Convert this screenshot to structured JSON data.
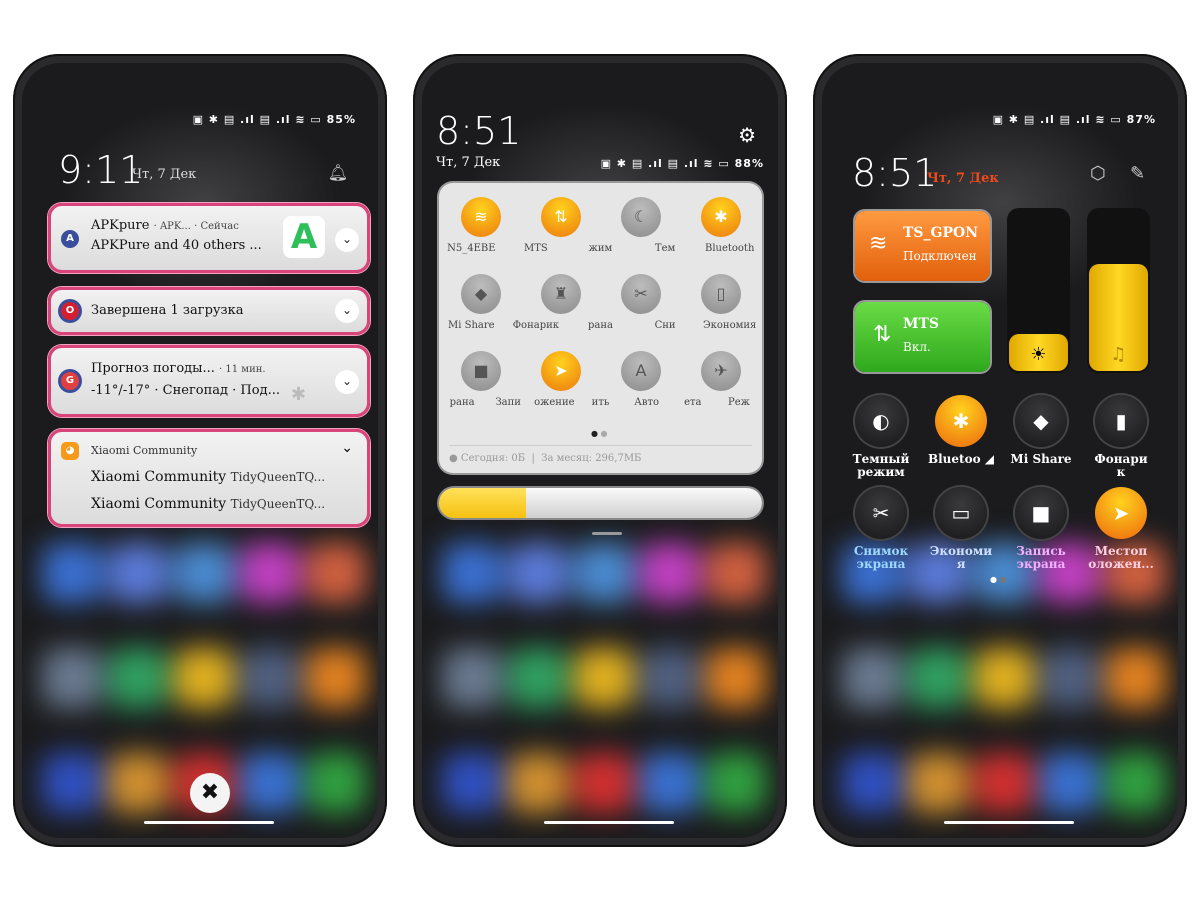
{
  "phone1": {
    "status": {
      "battery": "85%"
    },
    "time": "9:11",
    "date": "Чт, 7 Дек",
    "notifications": [
      {
        "app": "APKpure",
        "title": "APKpure",
        "meta": "· APK...  · Сейчас",
        "text": "APKPure and 40 others ...",
        "icon_color": "#3a4f9c"
      },
      {
        "app": "Opera",
        "title": "Завершена 1 загрузка",
        "icon_color": "#d32030"
      },
      {
        "app": "Weather",
        "title": "Прогноз погоды...",
        "meta": "· 11 мин.",
        "text": "-11°/-17° · Снегопад · Под...",
        "icon_color": "#e04040"
      },
      {
        "app": "Xiaomi Community",
        "header": "Xiaomi Community",
        "lines": [
          {
            "a": "Xiaomi Community",
            "b": "TidyQueenTQ..."
          },
          {
            "a": "Xiaomi Community",
            "b": "TidyQueenTQ..."
          }
        ],
        "icon_color": "#f59a1a"
      }
    ],
    "clear_icon": "close-icon"
  },
  "phone2": {
    "time": "8:51",
    "date": "Чт, 7 Дек",
    "status": {
      "battery": "88%"
    },
    "tiles": [
      {
        "label": "N5_4EBE",
        "on": true,
        "icon": "wifi-icon",
        "g": "≋"
      },
      {
        "label": "MTS",
        "on": true,
        "icon": "mobile-data-icon",
        "g": "⇅"
      },
      {
        "label": "жим",
        "on": false,
        "icon": "dark-mode-icon",
        "g": "☾"
      },
      {
        "label": "Тем",
        "on": false,
        "icon": "theme-icon",
        "g": ""
      },
      {
        "label": "Bluetooth",
        "on": true,
        "icon": "bluetooth-icon",
        "g": "✱"
      },
      {
        "label": "Mi Share",
        "on": false,
        "icon": "mi-share-icon",
        "g": "◆"
      },
      {
        "label": "Фонарик",
        "on": false,
        "icon": "flashlight-icon",
        "g": "♜"
      },
      {
        "label": "рана",
        "on": false,
        "icon": "screenshot-icon",
        "g": "✂"
      },
      {
        "label": "Сни",
        "on": false,
        "icon": "screenshot-icon",
        "g": ""
      },
      {
        "label": "Экономия",
        "on": false,
        "icon": "battery-saver-icon",
        "g": "▯"
      },
      {
        "label": "рана",
        "on": false,
        "icon": "screen-record-icon",
        "g": "■"
      },
      {
        "label": "Запи",
        "on": false,
        "icon": "record-icon",
        "g": ""
      },
      {
        "label": "ожение",
        "on": true,
        "icon": "location-icon",
        "g": "➤"
      },
      {
        "label": "ить",
        "on": false,
        "icon": "auto-brightness-icon",
        "g": "A"
      },
      {
        "label": "Авто",
        "on": false,
        "icon": "auto-icon",
        "g": ""
      },
      {
        "label": "ета",
        "on": false,
        "icon": "airplane-icon",
        "g": "✈"
      },
      {
        "label": "Реж",
        "on": false,
        "icon": "mode-icon",
        "g": ""
      }
    ],
    "data_today": "Сегодня: 0Б",
    "data_month": "За месяц: 296,7МБ",
    "brightness": 0.27
  },
  "phone3": {
    "status": {
      "battery": "87%"
    },
    "time": "8:51",
    "date": "Чт, 7 Дек",
    "wifi": {
      "name": "TS_GPON",
      "status": "Подключен",
      "color": "#e86a10"
    },
    "mobile": {
      "name": "MTS",
      "status": "Вкл.",
      "color": "#3cb82a"
    },
    "brightness": 0.25,
    "volume": 0.67,
    "tiles": [
      {
        "l1": "Темный",
        "l2": "режим",
        "on": false,
        "icon": "dark-mode-icon",
        "g": "◐"
      },
      {
        "l1": "Bluetoo ◢",
        "l2": "",
        "on": true,
        "icon": "bluetooth-icon",
        "g": "✱"
      },
      {
        "l1": "Mi Share",
        "l2": "",
        "on": false,
        "icon": "mi-share-icon",
        "g": "◆"
      },
      {
        "l1": "Фонари",
        "l2": "к",
        "on": false,
        "icon": "flashlight-icon",
        "g": "▮"
      },
      {
        "l1": "Снимок",
        "l2": "экрана",
        "on": false,
        "icon": "screenshot-icon",
        "g": "✂"
      },
      {
        "l1": "Экономи",
        "l2": "я",
        "on": false,
        "icon": "battery-saver-icon",
        "g": "▭"
      },
      {
        "l1": "Запись",
        "l2": "экрана",
        "on": false,
        "icon": "screen-record-icon",
        "g": "■"
      },
      {
        "l1": "Местоп",
        "l2": "оложен...",
        "on": true,
        "icon": "location-icon",
        "g": "➤"
      }
    ]
  }
}
